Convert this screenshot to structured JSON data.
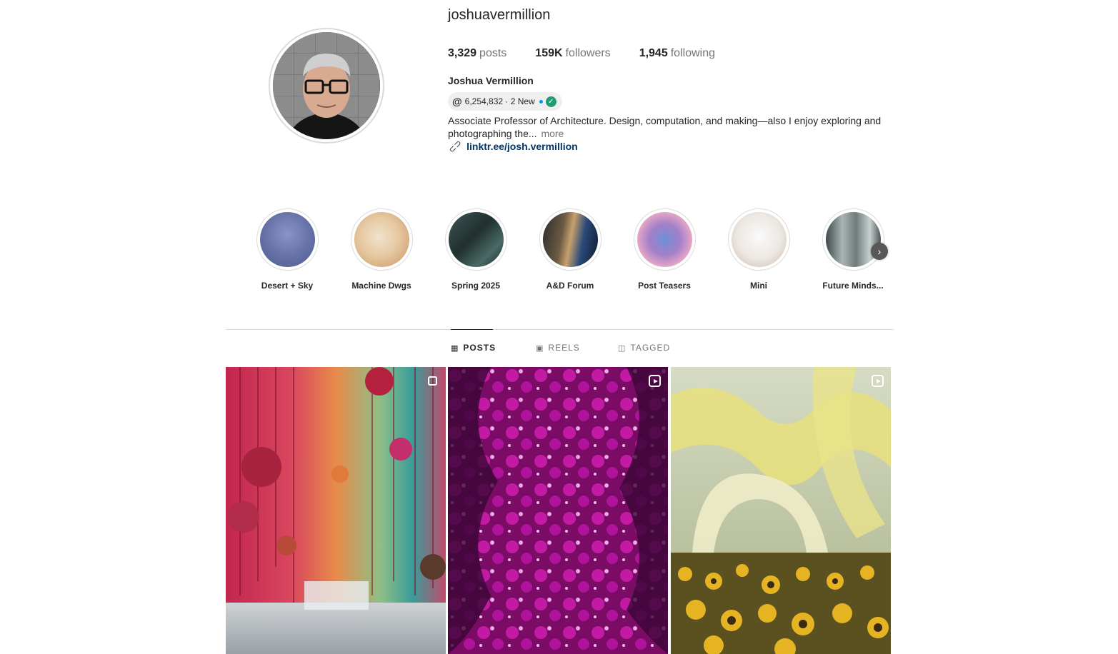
{
  "profile": {
    "username": "joshuavermillion",
    "stats": {
      "posts_count": "3,329",
      "posts_label": "posts",
      "followers_count": "159K",
      "followers_label": "followers",
      "following_count": "1,945",
      "following_label": "following"
    },
    "full_name": "Joshua Vermillion",
    "threads_badge": {
      "text": "6,254,832 · 2 New"
    },
    "bio": "Associate Professor of Architecture. Design, computation, and making—also I enjoy exploring and photographing the...",
    "bio_more": "more",
    "link": "linktr.ee/josh.vermillion"
  },
  "highlights": [
    {
      "label": "Desert + Sky"
    },
    {
      "label": "Machine Dwgs"
    },
    {
      "label": "Spring 2025"
    },
    {
      "label": "A&D Forum"
    },
    {
      "label": "Post Teasers"
    },
    {
      "label": "Mini"
    },
    {
      "label": "Future Minds..."
    }
  ],
  "tabs": [
    {
      "label": "POSTS",
      "icon": "grid-icon",
      "active": true
    },
    {
      "label": "REELS",
      "icon": "reels-icon",
      "active": false
    },
    {
      "label": "TAGGED",
      "icon": "tagged-icon",
      "active": false
    }
  ],
  "posts": [
    {
      "type": "carousel",
      "icon": "carousel-icon"
    },
    {
      "type": "reel",
      "icon": "reel-icon"
    },
    {
      "type": "reel",
      "icon": "reel-icon"
    }
  ],
  "colors": {
    "link": "#00376b",
    "muted": "#737373",
    "verified": "#1f9d78",
    "new_dot": "#0095f6"
  }
}
